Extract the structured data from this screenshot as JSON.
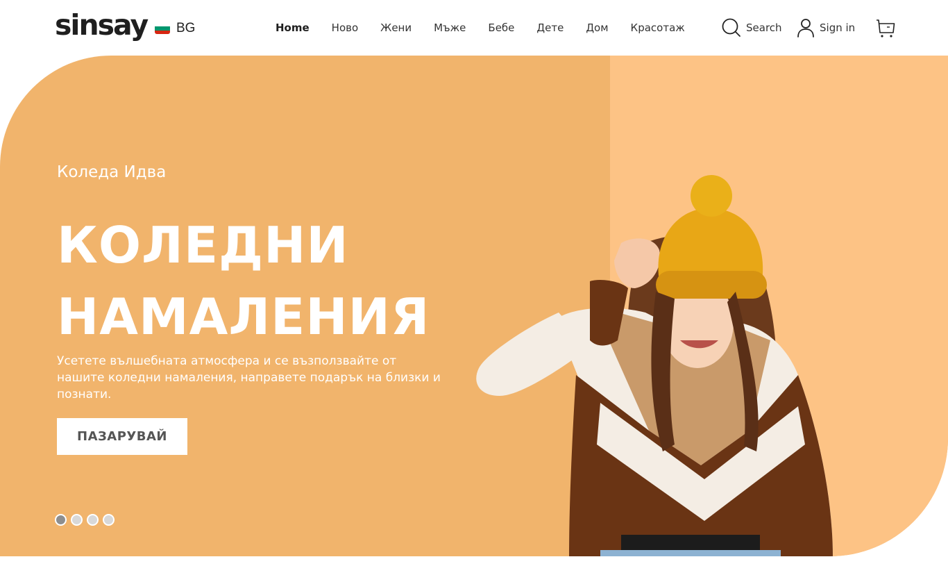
{
  "brand": {
    "logo_text": "sinsay"
  },
  "header": {
    "language": {
      "code": "BG",
      "flag_colors": [
        "#ffffff",
        "#00966e",
        "#d62612"
      ]
    },
    "nav": [
      {
        "label": "Home",
        "active": true
      },
      {
        "label": "Ново",
        "active": false
      },
      {
        "label": "Жени",
        "active": false
      },
      {
        "label": "Мъже",
        "active": false
      },
      {
        "label": "Бебе",
        "active": false
      },
      {
        "label": "Дете",
        "active": false
      },
      {
        "label": "Дом",
        "active": false
      },
      {
        "label": "Красотаж",
        "active": false
      }
    ],
    "actions": {
      "search_label": "Search",
      "signin_label": "Sign in",
      "search_icon": "search-icon",
      "user_icon": "user-icon",
      "cart_icon": "cart-icon"
    }
  },
  "hero": {
    "eyebrow": "Коледа Идва",
    "title_line1": "КОЛЕДНИ",
    "title_line2": "НАМАЛЕНИЯ",
    "description": "Усетете вълшебната атмосфера и се възползвайте от нашите коледни намаления, направете подарък на близки и познати.",
    "cta_label": "ПАЗАРУВАЙ",
    "slides_total": 4,
    "active_slide": 1,
    "colors": {
      "background": "#f1b46c",
      "right_panel": "#fdc385",
      "text": "#ffffff"
    }
  }
}
